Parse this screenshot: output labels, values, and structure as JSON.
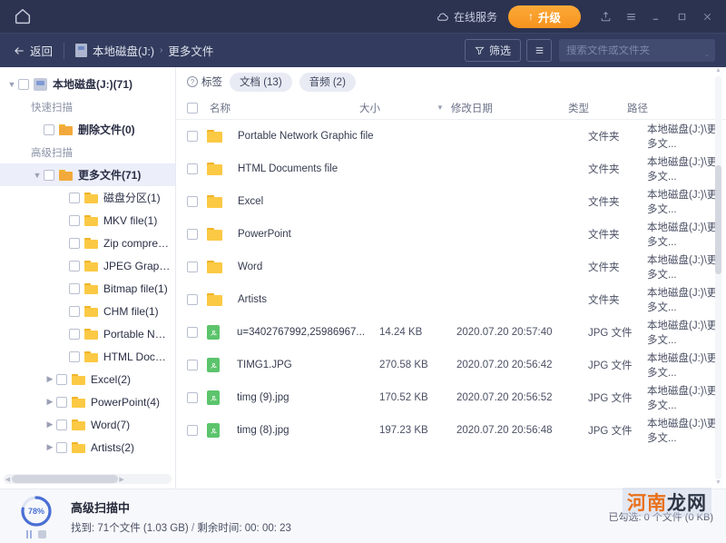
{
  "titlebar": {
    "home_icon": "home-icon",
    "online_service": "在线服务",
    "upgrade": "升级",
    "upgrade_arrow": "↑",
    "share_icon": "share-icon",
    "menu_icon": "menu-icon",
    "minimize_icon": "minimize-icon",
    "maximize_icon": "maximize-icon",
    "close_icon": "close-icon"
  },
  "toolbar": {
    "back": "返回",
    "breadcrumb": [
      "本地磁盘(J:)",
      "更多文件"
    ],
    "crumb_sep": "›",
    "filter": "筛选",
    "list_view_icon": "list-view-icon",
    "search_placeholder": "搜索文件或文件夹",
    "search_value": ""
  },
  "sidebar": {
    "items": [
      {
        "label": "本地磁盘(J:)(71)",
        "indent": 0,
        "chev": "v",
        "checkbox": true,
        "icon": "disk",
        "bold": true,
        "selected": false
      },
      {
        "label": "快速扫描",
        "indent": 1,
        "chev": "",
        "checkbox": false,
        "icon": "none",
        "bold": false,
        "selected": false,
        "section": true
      },
      {
        "label": "删除文件(0)",
        "indent": 2,
        "chev": "",
        "checkbox": true,
        "icon": "folder-orange",
        "bold": true,
        "selected": false
      },
      {
        "label": "高级扫描",
        "indent": 1,
        "chev": "",
        "checkbox": false,
        "icon": "none",
        "bold": false,
        "selected": false,
        "section": true
      },
      {
        "label": "更多文件(71)",
        "indent": 2,
        "chev": "v",
        "checkbox": true,
        "icon": "folder-orange",
        "bold": true,
        "selected": true
      },
      {
        "label": "磁盘分区(1)",
        "indent": 4,
        "chev": "",
        "checkbox": true,
        "icon": "folder",
        "bold": false,
        "selected": false
      },
      {
        "label": "MKV file(1)",
        "indent": 4,
        "chev": "",
        "checkbox": true,
        "icon": "folder",
        "bold": false,
        "selected": false
      },
      {
        "label": "Zip compress...",
        "indent": 4,
        "chev": "",
        "checkbox": true,
        "icon": "folder",
        "bold": false,
        "selected": false
      },
      {
        "label": "JPEG Graphic...",
        "indent": 4,
        "chev": "",
        "checkbox": true,
        "icon": "folder",
        "bold": false,
        "selected": false
      },
      {
        "label": "Bitmap file(1)",
        "indent": 4,
        "chev": "",
        "checkbox": true,
        "icon": "folder",
        "bold": false,
        "selected": false
      },
      {
        "label": "CHM file(1)",
        "indent": 4,
        "chev": "",
        "checkbox": true,
        "icon": "folder",
        "bold": false,
        "selected": false
      },
      {
        "label": "Portable Net...",
        "indent": 4,
        "chev": "",
        "checkbox": true,
        "icon": "folder",
        "bold": false,
        "selected": false
      },
      {
        "label": "HTML Docum...",
        "indent": 4,
        "chev": "",
        "checkbox": true,
        "icon": "folder",
        "bold": false,
        "selected": false
      },
      {
        "label": "Excel(2)",
        "indent": 3,
        "chev": ">",
        "checkbox": true,
        "icon": "folder",
        "bold": false,
        "selected": false
      },
      {
        "label": "PowerPoint(4)",
        "indent": 3,
        "chev": ">",
        "checkbox": true,
        "icon": "folder",
        "bold": false,
        "selected": false
      },
      {
        "label": "Word(7)",
        "indent": 3,
        "chev": ">",
        "checkbox": true,
        "icon": "folder",
        "bold": false,
        "selected": false
      },
      {
        "label": "Artists(2)",
        "indent": 3,
        "chev": ">",
        "checkbox": true,
        "icon": "folder",
        "bold": false,
        "selected": false
      }
    ]
  },
  "main": {
    "tag_label": "标签",
    "tag_help_icon": "question-icon",
    "tabs": [
      {
        "label": "文档 (13)"
      },
      {
        "label": "音频 (2)"
      }
    ],
    "columns": {
      "name": "名称",
      "size": "大小",
      "date": "修改日期",
      "type": "类型",
      "path": "路径"
    },
    "sort_icon": "sort-descending-icon",
    "rows": [
      {
        "name": "Portable Network Graphic file",
        "size": "",
        "date": "",
        "type": "文件夹",
        "path": "本地磁盘(J:)\\更多文...",
        "icon": "folder"
      },
      {
        "name": "HTML Documents file",
        "size": "",
        "date": "",
        "type": "文件夹",
        "path": "本地磁盘(J:)\\更多文...",
        "icon": "folder"
      },
      {
        "name": "Excel",
        "size": "",
        "date": "",
        "type": "文件夹",
        "path": "本地磁盘(J:)\\更多文...",
        "icon": "folder"
      },
      {
        "name": "PowerPoint",
        "size": "",
        "date": "",
        "type": "文件夹",
        "path": "本地磁盘(J:)\\更多文...",
        "icon": "folder"
      },
      {
        "name": "Word",
        "size": "",
        "date": "",
        "type": "文件夹",
        "path": "本地磁盘(J:)\\更多文...",
        "icon": "folder"
      },
      {
        "name": "Artists",
        "size": "",
        "date": "",
        "type": "文件夹",
        "path": "本地磁盘(J:)\\更多文...",
        "icon": "folder"
      },
      {
        "name": "u=3402767992,25986967...",
        "size": "14.24 KB",
        "date": "2020.07.20 20:57:40",
        "type": "JPG 文件",
        "path": "本地磁盘(J:)\\更多文...",
        "icon": "jpg"
      },
      {
        "name": "TIMG1.JPG",
        "size": "270.58 KB",
        "date": "2020.07.20 20:56:42",
        "type": "JPG 文件",
        "path": "本地磁盘(J:)\\更多文...",
        "icon": "jpg"
      },
      {
        "name": "timg (9).jpg",
        "size": "170.52 KB",
        "date": "2020.07.20 20:56:52",
        "type": "JPG 文件",
        "path": "本地磁盘(J:)\\更多文...",
        "icon": "jpg"
      },
      {
        "name": "timg (8).jpg",
        "size": "197.23 KB",
        "date": "2020.07.20 20:56:48",
        "type": "JPG 文件",
        "path": "本地磁盘(J:)\\更多文...",
        "icon": "jpg"
      }
    ]
  },
  "status": {
    "progress_percent": "78%",
    "progress_value": 78,
    "title": "高级扫描中",
    "found_label": "找到:",
    "found_value": "71个文件 (1.03 GB)",
    "separator": "/",
    "remain_label": "剩余时间:",
    "remain_value": "00: 00: 23",
    "selected_text": "已勾选: 0 个文件 (0 KB)",
    "pause_icon": "pause-icon",
    "stop_icon": "stop-icon"
  },
  "watermark": {
    "part1": "河南",
    "part2": "龙网"
  },
  "colors": {
    "titlebar": "#2c3351",
    "toolbar": "#333c5e",
    "accent_orange": "#f7931e",
    "folder_yellow": "#fbc944",
    "jpg_green": "#5cc46c",
    "progress_blue": "#4a6fd4",
    "selected_row": "#eceefa"
  }
}
